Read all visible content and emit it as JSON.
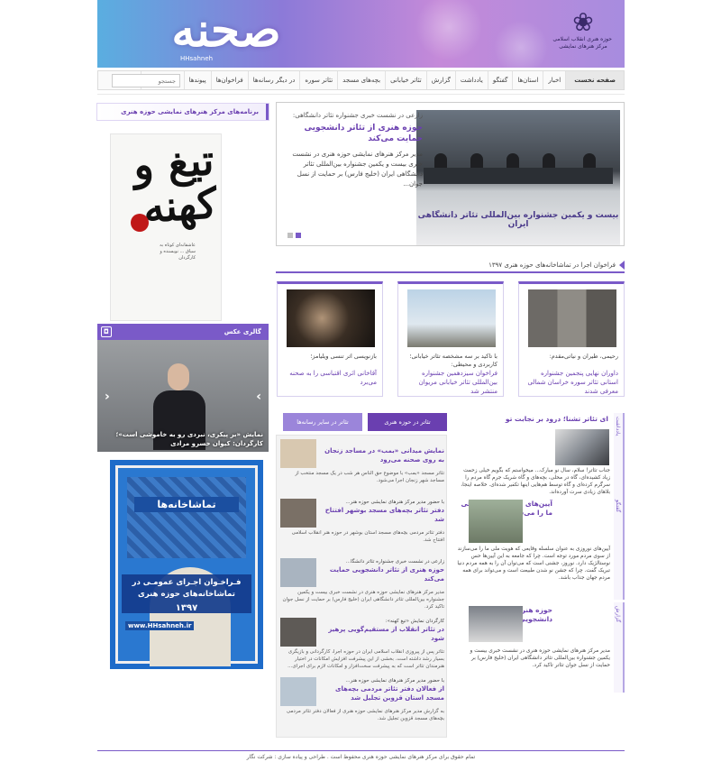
{
  "header": {
    "logo_script": "صحنه",
    "logo_sub": "HHsahneh",
    "org_line1": "حوزه هنری انقلاب اسلامی",
    "org_line2": "مرکز هنرهای نمایشی"
  },
  "nav": {
    "items": [
      "صفحه نخست",
      "اخبار",
      "استان‌ها",
      "گفتگو",
      "یادداشت",
      "گزارش",
      "تئاتر خیابانی",
      "بچه‌های مسجد",
      "تئاتر سوره",
      "در دیگر رسانه‌ها",
      "فراخوان‌ها",
      "پیوندها",
      "گالری عکس"
    ],
    "search_placeholder": "جستجو"
  },
  "left": {
    "programs_head": "برنامه‌های مرکز هنرهای نمایشی حوزه هنری",
    "poster_title": "تیغ و کهنه",
    "poster_lines": "عاشقانه‌ای کوتاه به سیاق ... نویسنده و کارگردان",
    "gallery_head": "گالری عکس",
    "gallery_caption": "نمایش «بر پیکری، نبردی رو به خاموشی است»؛ کارگردان: کیوان خسرو مرادی",
    "ad": {
      "title": "تماشاخانه‌ها",
      "line": "فـراخـوان اجـرای عمومـی در تماشاخانه‌های حوزه هنری",
      "year": "۱۳۹۷",
      "url": "www.HHsahneh.ir"
    }
  },
  "slider": {
    "kicker": "زارعی در نشست خبری جشنواره تئاتر دانشگاهی:",
    "title": "حوزه هنری از تئاتر دانشجویی حمایت می‌کند",
    "desc": "مدیر مرکز هنرهای نمایشی حوزه هنری در نشست خبری بیست و یکمین جشنواره بین‌المللی تئاتر دانشگاهی ایران (خلیج فارس) بر حمایت از نسل جوان...",
    "banner": "بیست و یکمین جشنواره بین‌المللی تئاتر دانشگاهی ایران"
  },
  "calls": {
    "head": "فراخوان اجرا در تماشاخانه‌های حوزه هنری ۱۳۹۷",
    "cards": [
      {
        "kicker": "رحیمی، طیران و نیاتی‌مقدم:",
        "title": "داوران نهایی پنجمین جشنواره استانی تئاتر سوره خراسان شمالی معرفی شدند"
      },
      {
        "kicker": "با تاکید بر سه مشخصه تئاتر خیابانی؛ کاربردی و محیطی:",
        "title": "فراخوان سیزدهمین جشنواره بین‌المللی تئاتر خیابانی مریوان منتشر شد"
      },
      {
        "kicker": "بازنویسی اثر تنسی ویلیامز؛",
        "title": "آقاخانی اثری اقتباسی را به صحنه می‌برد"
      }
    ]
  },
  "tabs": {
    "active": "تئاتر در حوزه هنری",
    "other": "تئاتر در سایر رسانه‌ها"
  },
  "news": [
    {
      "kicker": "",
      "title": "نمایش میدانی «بمب» در مساجد زنجان به روی صحنه می‌رود",
      "desc": "تئاتر مسجد «بمب» با موضوع حق الناس هر شب در یک مسجد منتخب از مساجد شهر زنجان اجرا می‌شود."
    },
    {
      "kicker": "با حضور مدیر مرکز هنرهای نمایشی حوزه هنر...",
      "title": "دفتر تئاتر بچه‌های مسجد بوشهر افتتاح شد",
      "desc": "دفتر تئاتر مردمی بچه‌های مسجد استان بوشهر در حوزه هنر انقلاب اسلامی افتتاح شد."
    },
    {
      "kicker": "زارعی در نشست خبری جشنواره تئاتر دانشگا...",
      "title": "حوزه هنری از تئاتر دانشجویی حمایت می‌کند",
      "desc": "مدیر مرکز هنرهای نمایشی حوزه هنری در نشست خبری بیست و یکمین جشنواره بین‌المللی تئاتر دانشگاهی ایران (خلیج فارس) بر حمایت از نسل جوان تاکید کرد."
    },
    {
      "kicker": "کارگردان نمایش «تیغ کهنه»:",
      "title": "در تئاتر انقلاب از مستقیم‌گویی پرهیز شود",
      "desc": "تئاتر پس از پیروزی انقلاب اسلامی ایران در حوزه اجرا، کارگردانی و بازیگری بسیار رشد داشته است. بخشی از این پیشرفت افزایش امکانات در اختیار هنرمندان تئاتر است که به پیشرفت سخت‌افزار و امکانات لازم برای اجرای..."
    },
    {
      "kicker": "با حضور مدیر مرکز هنرهای نمایشی حوزه هنر...",
      "title": "از فعالان دفتر تئاتر مردمی بچه‌های مسجد استان قزوین تجلیل شد",
      "desc": "به گزارش مدیر مرکز هنرهای نمایشی حوزه هنری از فعالان دفتر تئاتر مردمی بچه‌های مسجد قزوین تجلیل شد."
    }
  ],
  "right": [
    {
      "side": "یادداشت",
      "title": "ای تئاتر تشنا؛ درود بر نجابت تو",
      "desc": "جناب تئاتر! سلام، سال نو مبارک... میخواستم که بگویم خیلی زحمت زیاد کشیده‌ای، گاه در محلی، بچه‌های و گاه شریک جرم گاه مردم را سرگرم کرده‌ای و گاه توسط هم‌هایی اینها تکفیر شده‌ای. خلاصه اینجا، بلاهای زیادی سرت آورده‌اند."
    },
    {
      "side": "گفتگو",
      "title": "آیین‌های نوروزی هویت ملی ما را می‌سازند",
      "desc": "آیین‌های نوروزی به عنوان سلسله وقایعی که هویت ملی ما را می‌سازند از سوی مردم مورد توجه است. چرا که جامعه به این آیین‌ها حس نوستالژیک دارد. نوروز، جشنی است که می‌توان آن را به همه مردم دنیا تبریک گفت. چرا که جشن نو شدن طبیعت است و می‌تواند برای همه مردم جهان جذاب باشد."
    },
    {
      "side": "گزارش",
      "title": "حوزه هنری از تئاتر دانشجویی حمایت می‌کند",
      "desc": "مدیر مرکز هنرهای نمایشی حوزه هنری در نشست خبری بیست و یکمین جشنواره بین‌المللی تئاتر دانشگاهی ایران (خلیج فارس) بر حمایت از نسل جوان تئاتر تاکید کرد."
    }
  ],
  "footer": "تمام حقوق برای مرکز هنرهای نمایشی حوزه هنری محفوظ است . طراحی و پیاده سازی : شرکت نگار",
  "colors": {
    "accent": "#7a5ac8",
    "title": "#6a3fb0"
  }
}
